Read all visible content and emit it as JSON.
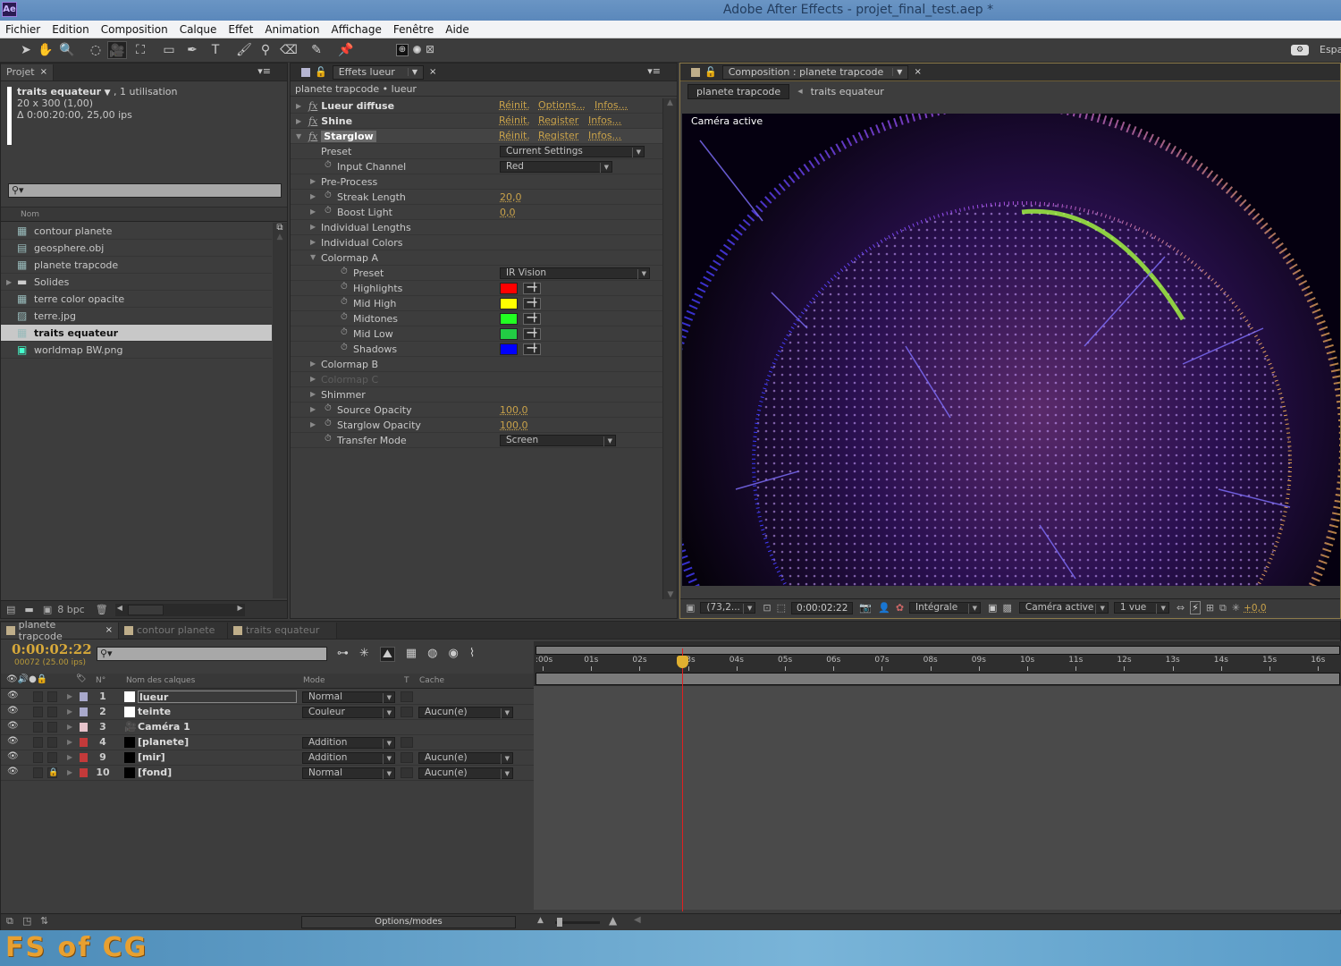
{
  "window": {
    "title": "Adobe After Effects - projet_final_test.aep *",
    "app_icon": "Ae"
  },
  "menu": [
    "Fichier",
    "Edition",
    "Composition",
    "Calque",
    "Effet",
    "Animation",
    "Affichage",
    "Fenêtre",
    "Aide"
  ],
  "toolbar": {
    "tools": [
      {
        "name": "selection-tool-icon",
        "glyph": "➤"
      },
      {
        "name": "hand-tool-icon",
        "glyph": "✋"
      },
      {
        "name": "zoom-tool-icon",
        "glyph": "🔍"
      },
      {
        "name": "rotate-tool-icon",
        "glyph": "◌"
      },
      {
        "name": "camera-tool-icon",
        "glyph": "🎥"
      },
      {
        "name": "pan-behind-tool-icon",
        "glyph": "⛶"
      },
      {
        "name": "rectangle-tool-icon",
        "glyph": "▭"
      },
      {
        "name": "pen-tool-icon",
        "glyph": "✒"
      },
      {
        "name": "text-tool-icon",
        "glyph": "T"
      },
      {
        "name": "brush-tool-icon",
        "glyph": "🖌"
      },
      {
        "name": "clone-stamp-tool-icon",
        "glyph": "⚲"
      },
      {
        "name": "eraser-tool-icon",
        "glyph": "⌫"
      },
      {
        "name": "roto-brush-tool-icon",
        "glyph": "✎"
      },
      {
        "name": "puppet-pin-tool-icon",
        "glyph": "📌"
      }
    ],
    "workspace_label": "Espa"
  },
  "project": {
    "tab": "Projet",
    "selected_name": "traits equateur",
    "usage": ", 1 utilisation",
    "dimensions": "20 x 300 (1,00)",
    "duration": "Δ 0:00:20:00, 25,00 ips",
    "column_name": "Nom",
    "items": [
      {
        "name": "contour planete",
        "type": "composition"
      },
      {
        "name": "geosphere.obj",
        "type": "file"
      },
      {
        "name": "planete trapcode",
        "type": "composition"
      },
      {
        "name": "Solides",
        "type": "folder"
      },
      {
        "name": "terre color opacite",
        "type": "composition"
      },
      {
        "name": "terre.jpg",
        "type": "image"
      },
      {
        "name": "traits equateur",
        "type": "composition",
        "selected": true
      },
      {
        "name": "worldmap BW.png",
        "type": "png"
      }
    ],
    "bpc": "8 bpc"
  },
  "effects": {
    "tab": "Effets lueur",
    "breadcrumb": "planete trapcode • lueur",
    "effects": [
      {
        "name": "Lueur diffuse",
        "links": [
          "Réinit.",
          "Options...",
          "Infos..."
        ]
      },
      {
        "name": "Shine",
        "links": [
          "Réinit.",
          "Register",
          "Infos..."
        ]
      },
      {
        "name": "Starglow",
        "links": [
          "Réinit.",
          "Register",
          "Infos..."
        ]
      }
    ],
    "params": [
      {
        "label": "Preset",
        "kind": "dropdown",
        "value": "Current Settings",
        "indent": 1,
        "stopwatch": false,
        "twirl": false
      },
      {
        "label": "Input Channel",
        "kind": "dropdown",
        "value": "Red",
        "indent": 1,
        "stopwatch": true,
        "twirl": false
      },
      {
        "label": "Pre-Process",
        "kind": "group",
        "indent": 1,
        "twirl": true
      },
      {
        "label": "Streak Length",
        "kind": "number",
        "value": "20,0",
        "indent": 1,
        "stopwatch": true,
        "twirl": true
      },
      {
        "label": "Boost Light",
        "kind": "number",
        "value": "0,0",
        "indent": 1,
        "stopwatch": true,
        "twirl": true
      },
      {
        "label": "Individual Lengths",
        "kind": "group",
        "indent": 1,
        "twirl": true
      },
      {
        "label": "Individual Colors",
        "kind": "group",
        "indent": 1,
        "twirl": true
      },
      {
        "label": "Colormap A",
        "kind": "group-open",
        "indent": 1,
        "twirl": true
      },
      {
        "label": "Preset",
        "kind": "dropdown",
        "value": "IR Vision",
        "indent": 2,
        "stopwatch": true
      },
      {
        "label": "Highlights",
        "kind": "color",
        "value": "#ff0000",
        "indent": 2,
        "stopwatch": true
      },
      {
        "label": "Mid High",
        "kind": "color",
        "value": "#ffff00",
        "indent": 2,
        "stopwatch": true
      },
      {
        "label": "Midtones",
        "kind": "color",
        "value": "#22ff22",
        "indent": 2,
        "stopwatch": true
      },
      {
        "label": "Mid Low",
        "kind": "color",
        "value": "#22cc44",
        "indent": 2,
        "stopwatch": true
      },
      {
        "label": "Shadows",
        "kind": "color",
        "value": "#0000ff",
        "indent": 2,
        "stopwatch": true
      },
      {
        "label": "Colormap B",
        "kind": "group",
        "indent": 1,
        "twirl": true
      },
      {
        "label": "Colormap C",
        "kind": "group-disabled",
        "indent": 1,
        "twirl": true
      },
      {
        "label": "Shimmer",
        "kind": "group",
        "indent": 1,
        "twirl": true
      },
      {
        "label": "Source Opacity",
        "kind": "number",
        "value": "100,0",
        "indent": 1,
        "stopwatch": true,
        "twirl": true
      },
      {
        "label": "Starglow Opacity",
        "kind": "number",
        "value": "100,0",
        "indent": 1,
        "stopwatch": true,
        "twirl": true
      },
      {
        "label": "Transfer Mode",
        "kind": "dropdown",
        "value": "Screen",
        "indent": 1,
        "stopwatch": true,
        "twirl": false
      }
    ]
  },
  "composition": {
    "tab": "Composition : planete trapcode",
    "crumbs": [
      "planete trapcode",
      "traits equateur"
    ],
    "viewer_label": "Caméra active",
    "footer": {
      "zoom": "(73,2...",
      "timecode": "0:00:02:22",
      "resolution": "Intégrale",
      "camera": "Caméra active",
      "views": "1 vue",
      "exposure": "+0,0"
    }
  },
  "timeline": {
    "tabs": [
      "planete trapcode",
      "contour planete",
      "traits equateur"
    ],
    "timecode": "0:00:02:22",
    "frame_info": "00072 (25.00 ips)",
    "columns": {
      "num": "N°",
      "name": "Nom des calques",
      "mode": "Mode",
      "t": "T",
      "cache": "Cache"
    },
    "ruler": [
      ":00s",
      "01s",
      "02s",
      "03s",
      "04s",
      "05s",
      "06s",
      "07s",
      "08s",
      "09s",
      "10s",
      "11s",
      "12s",
      "13s",
      "14s",
      "15s",
      "16s"
    ],
    "playhead_seconds": 2.88,
    "layers": [
      {
        "num": "1",
        "name": "lueur",
        "label_color": "#a9a9cc",
        "icon": "white-solid",
        "mode": "Normal",
        "cache": null,
        "bar_color": "#9d9dbb",
        "locked": false,
        "editing": true
      },
      {
        "num": "2",
        "name": "teinte",
        "label_color": "#a9a9cc",
        "icon": "white-solid",
        "mode": "Couleur",
        "cache": "Aucun(e)",
        "bar_color": "#7a7f96",
        "locked": false
      },
      {
        "num": "3",
        "name": "Caméra 1",
        "label_color": "#e6c3cb",
        "icon": "camera",
        "mode": null,
        "cache": null,
        "bar_color": "#a7808a",
        "locked": false
      },
      {
        "num": "4",
        "name": "[planete]",
        "label_color": "#c43a3a",
        "icon": "black-solid",
        "mode": "Addition",
        "cache": null,
        "bar_color": "#8a3a3a",
        "locked": false
      },
      {
        "num": "9",
        "name": "[mir]",
        "label_color": "#c43a3a",
        "icon": "black-solid",
        "mode": "Addition",
        "cache": "Aucun(e)",
        "bar_color": "#8a3a3a",
        "locked": false
      },
      {
        "num": "10",
        "name": "[fond]",
        "label_color": "#c43a3a",
        "icon": "black-solid",
        "mode": "Normal",
        "cache": "Aucun(e)",
        "bar_color": "#8a3a3a",
        "locked": true
      }
    ],
    "options_label": "Options/modes"
  },
  "watermark": "FS of CG"
}
